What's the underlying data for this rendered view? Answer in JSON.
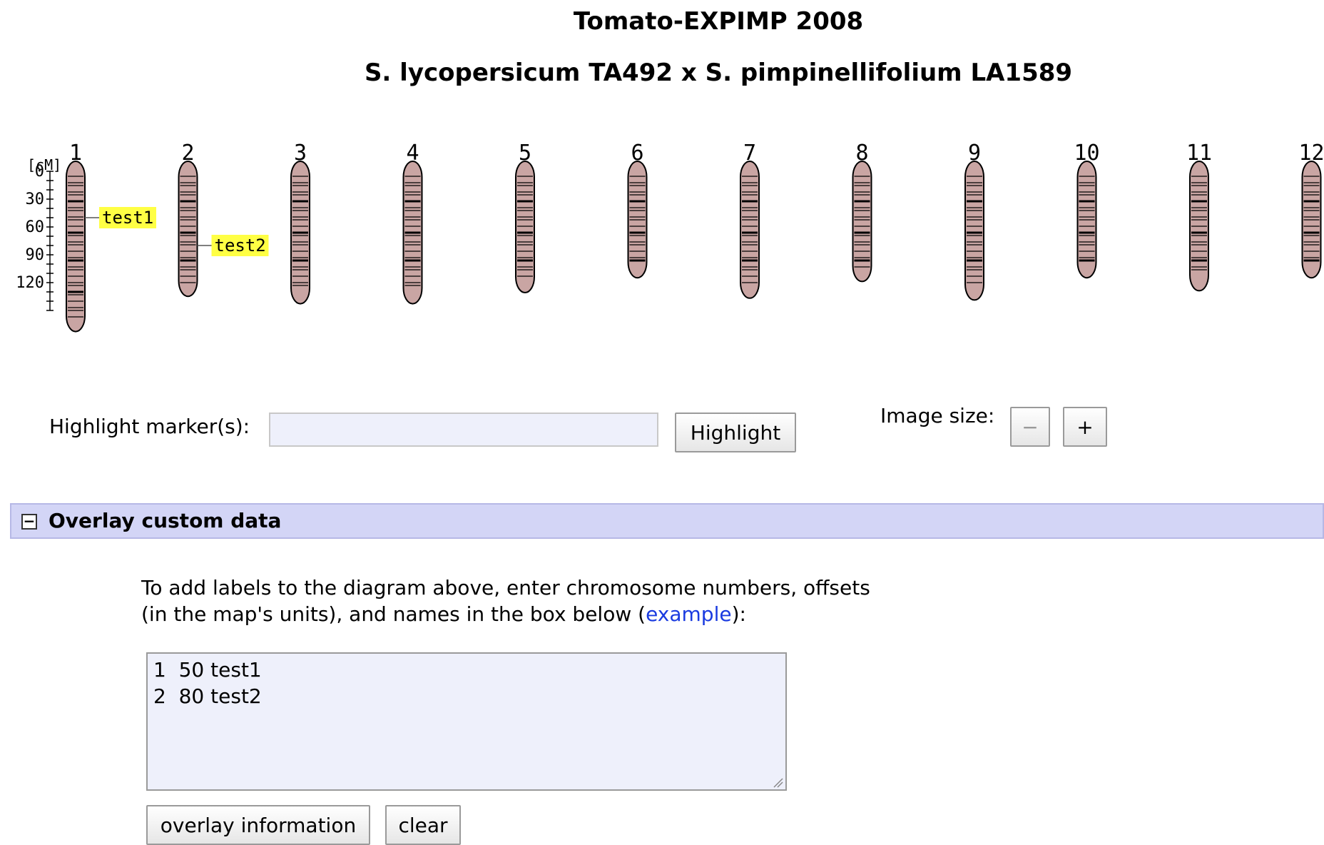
{
  "header": {
    "title": "Tomato-EXPIMP 2008",
    "subtitle": "S. lycopersicum TA492 x S. pimpinellifolium LA1589"
  },
  "map": {
    "unit_label": "[cM]",
    "axis_ticks": [
      "0",
      "30",
      "60",
      "90",
      "120"
    ],
    "chromosome_color": "#c9a5a3",
    "chromosomes": [
      {
        "label": "1",
        "length": 162
      },
      {
        "label": "2",
        "length": 124
      },
      {
        "label": "3",
        "length": 132
      },
      {
        "label": "4",
        "length": 132
      },
      {
        "label": "5",
        "length": 120
      },
      {
        "label": "6",
        "length": 104
      },
      {
        "label": "7",
        "length": 126
      },
      {
        "label": "8",
        "length": 108
      },
      {
        "label": "9",
        "length": 128
      },
      {
        "label": "10",
        "length": 104
      },
      {
        "label": "11",
        "length": 118
      },
      {
        "label": "12",
        "length": 104
      }
    ],
    "overlay_labels": [
      {
        "chromosome": "1",
        "offset": 50,
        "name": "test1"
      },
      {
        "chromosome": "2",
        "offset": 80,
        "name": "test2"
      }
    ],
    "label_color": "#ffff44"
  },
  "controls": {
    "highlight_label": "Highlight marker(s):",
    "highlight_value": "",
    "highlight_button": "Highlight",
    "image_size_label": "Image size:",
    "zoom_out": "−",
    "zoom_in": "+"
  },
  "overlay": {
    "toggle_symbol": "−",
    "section_title": "Overlay custom data",
    "instructions_before": "To add labels to the diagram above, enter chromosome numbers, offsets",
    "instructions_line2_before": "(in the map's units), and names in the box below (",
    "example_link": "example",
    "instructions_after": "):",
    "textarea_value": "1  50 test1\n2  80 test2",
    "overlay_button": "overlay information",
    "clear_button": "clear"
  }
}
